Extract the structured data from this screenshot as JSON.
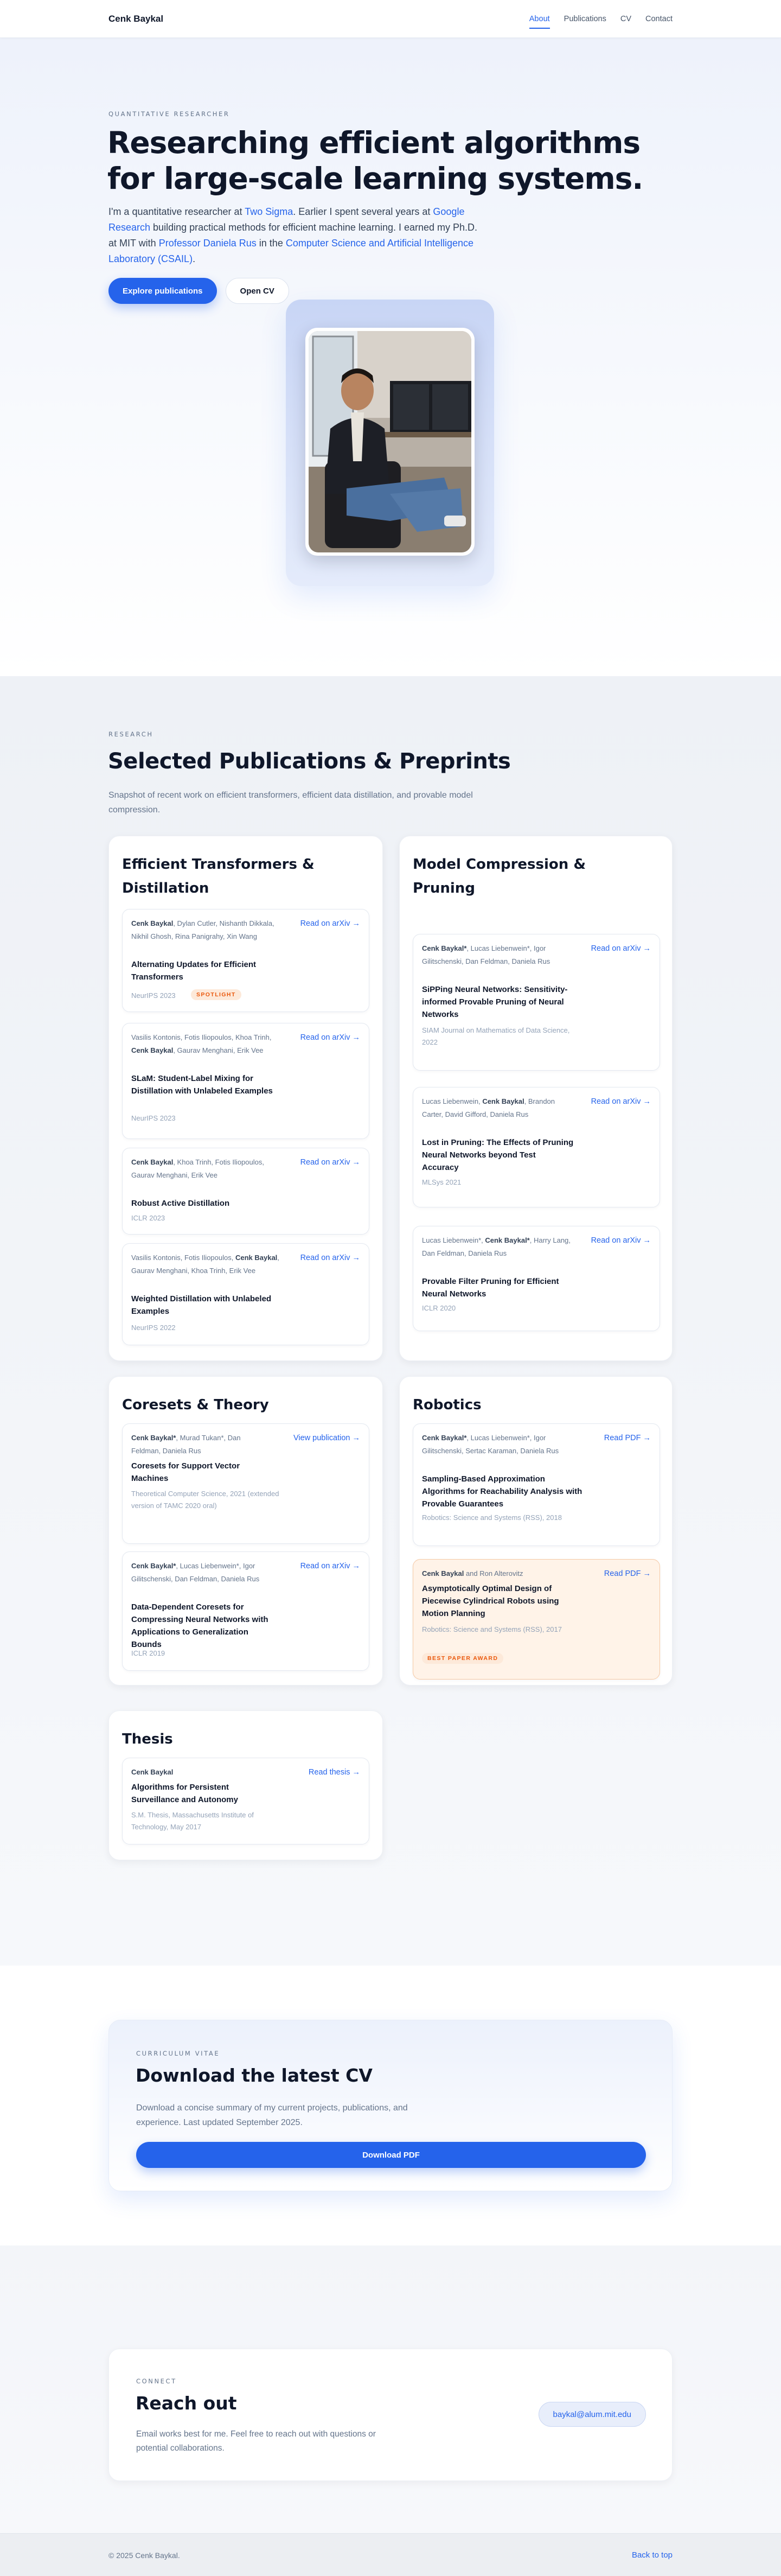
{
  "nav": {
    "brand": "Cenk Baykal",
    "links": [
      "About",
      "Publications",
      "CV",
      "Contact"
    ],
    "active": "About"
  },
  "hero": {
    "eyebrow": "QUANTITATIVE RESEARCHER",
    "title": "Researching efficient algorithms for large-scale learning systems.",
    "intro": {
      "t1": "I'm a quantitative researcher at ",
      "l1": "Two Sigma",
      "t2": ". Earlier I spent several years at ",
      "l2": "Google Research",
      "t3": " building practical methods for efficient machine learning. I earned my Ph.D. at MIT with ",
      "l3": "Professor Daniela Rus",
      "t4": " in the ",
      "l4": "Computer Science and Artificial Intelligence Laboratory (CSAIL)",
      "t5": "."
    },
    "primary_button": "Explore publications",
    "secondary_button": "Open CV"
  },
  "research": {
    "eyebrow": "RESEARCH",
    "title": "Selected Publications & Preprints",
    "subtitle": "Snapshot of recent work on efficient transformers, efficient data distillation, and provable model compression.",
    "groups": [
      {
        "title": "Efficient Transformers & Distillation",
        "pubs": [
          {
            "author_pre": "",
            "author_bold": "Cenk Baykal",
            "author_post": ", Dylan Cutler, Nishanth Dikkala, Nikhil Ghosh, Rina Panigrahy, Xin Wang",
            "title": "Alternating Updates for Efficient Transformers",
            "venue": "NeurIPS 2023",
            "link": "Read on arXiv →",
            "badge": "SPOTLIGHT"
          },
          {
            "author_pre": "Vasilis Kontonis, Fotis Iliopoulos, Khoa Trinh, ",
            "author_bold": "Cenk Baykal",
            "author_post": ", Gaurav Menghani, Erik Vee",
            "title": "SLaM: Student-Label Mixing for Distillation with Unlabeled Examples",
            "venue": "NeurIPS 2023",
            "link": "Read on arXiv →"
          },
          {
            "author_pre": "",
            "author_bold": "Cenk Baykal",
            "author_post": ", Khoa Trinh, Fotis Iliopoulos, Gaurav Menghani, Erik Vee",
            "title": "Robust Active Distillation",
            "venue": "ICLR 2023",
            "link": "Read on arXiv →"
          },
          {
            "author_pre": "Vasilis Kontonis, Fotis Iliopoulos, ",
            "author_bold": "Cenk Baykal",
            "author_post": ", Gaurav Menghani, Khoa Trinh, Erik Vee",
            "title": "Weighted Distillation with Unlabeled Examples",
            "venue": "NeurIPS 2022",
            "link": "Read on arXiv →"
          }
        ]
      },
      {
        "title": "Model Compression & Pruning",
        "pubs": [
          {
            "author_pre": "",
            "author_bold": "Cenk Baykal*",
            "author_post": ", Lucas Liebenwein*, Igor Gilitschenski, Dan Feldman, Daniela Rus",
            "title": "SiPPing Neural Networks: Sensitivity-informed Provable Pruning of Neural Networks",
            "venue": "SIAM Journal on Mathematics of Data Science, 2022",
            "link": "Read on arXiv →"
          },
          {
            "author_pre": "Lucas Liebenwein, ",
            "author_bold": "Cenk Baykal",
            "author_post": ", Brandon Carter, David Gifford, Daniela Rus",
            "title": "Lost in Pruning: The Effects of Pruning Neural Networks beyond Test Accuracy",
            "venue": "MLSys 2021",
            "link": "Read on arXiv →"
          },
          {
            "author_pre": "Lucas Liebenwein*, ",
            "author_bold": "Cenk Baykal*",
            "author_post": ", Harry Lang, Dan Feldman, Daniela Rus",
            "title": "Provable Filter Pruning for Efficient Neural Networks",
            "venue": "ICLR 2020",
            "link": "Read on arXiv →"
          }
        ]
      },
      {
        "title": "Coresets & Theory",
        "pubs": [
          {
            "author_pre": "",
            "author_bold": "Cenk Baykal*",
            "author_post": ", Murad Tukan*, Dan Feldman, Daniela Rus",
            "title": "Coresets for Support Vector Machines",
            "venue": "Theoretical Computer Science, 2021 (extended version of TAMC 2020 oral)",
            "link": "View publication →"
          },
          {
            "author_pre": "",
            "author_bold": "Cenk Baykal*",
            "author_post": ", Lucas Liebenwein*, Igor Gilitschenski, Dan Feldman, Daniela Rus",
            "title": "Data-Dependent Coresets for Compressing Neural Networks with Applications to Generalization Bounds",
            "venue": "ICLR 2019",
            "link": "Read on arXiv →"
          }
        ]
      },
      {
        "title": "Robotics",
        "pubs": [
          {
            "author_pre": "",
            "author_bold": "Cenk Baykal*",
            "author_post": ", Lucas Liebenwein*, Igor Gilitschenski, Sertac Karaman, Daniela Rus",
            "title": "Sampling-Based Approximation Algorithms for Reachability Analysis with Provable Guarantees",
            "venue": "Robotics: Science and Systems (RSS), 2018",
            "link": "Read PDF →"
          },
          {
            "author_pre": "",
            "author_bold": "Cenk Baykal",
            "author_post": " and Ron Alterovitz",
            "title": "Asymptotically Optimal Design of Piecewise Cylindrical Robots using Motion Planning",
            "venue": "Robotics: Science and Systems (RSS), 2017",
            "link": "Read PDF →",
            "badge": "BEST PAPER AWARD"
          }
        ]
      },
      {
        "title": "Thesis",
        "pubs": [
          {
            "author_pre": "",
            "author_bold": "Cenk Baykal",
            "author_post": "",
            "title": "Algorithms for Persistent Surveillance and Autonomy",
            "venue": "S.M. Thesis, Massachusetts Institute of Technology, May 2017",
            "link": "Read thesis →"
          }
        ]
      }
    ]
  },
  "cv": {
    "eyebrow": "CURRICULUM VITAE",
    "title": "Download the latest CV",
    "text": "Download a concise summary of my current projects, publications, and experience. Last updated September 2025.",
    "button": "Download PDF"
  },
  "contact": {
    "eyebrow": "CONNECT",
    "title": "Reach out",
    "text": "Email works best for me. Feel free to reach out with questions or potential collaborations.",
    "email": "baykal@alum.mit.edu"
  },
  "footer": {
    "copyright": "© 2025 Cenk Baykal.",
    "back_to_top": "Back to top"
  }
}
